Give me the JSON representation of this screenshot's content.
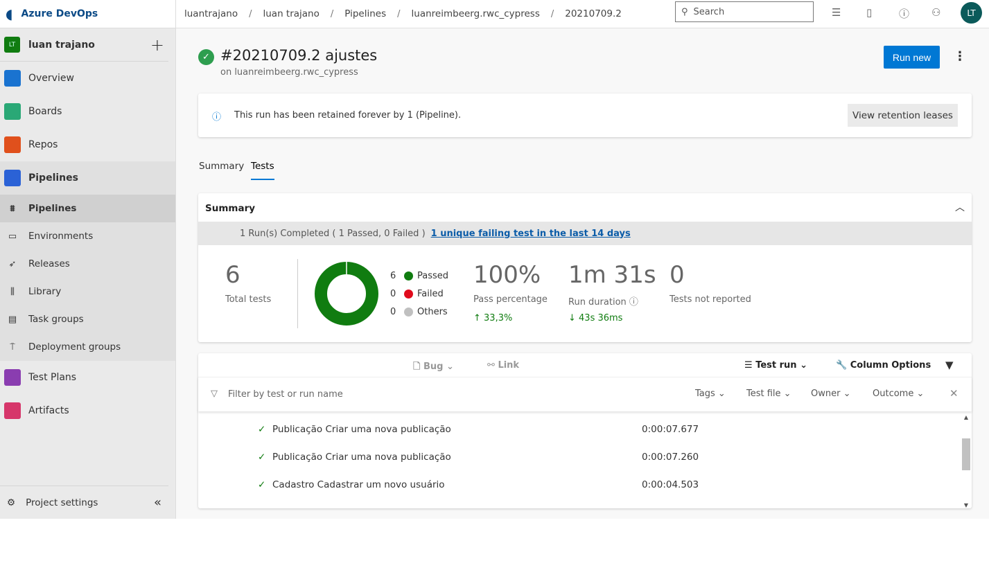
{
  "brand": "Azure DevOps",
  "project": {
    "initials": "LT",
    "name": "luan trajano"
  },
  "nav": [
    {
      "label": "Overview",
      "color": "#1a73d0"
    },
    {
      "label": "Boards",
      "color": "#2aa876"
    },
    {
      "label": "Repos",
      "color": "#e0501c"
    },
    {
      "label": "Pipelines",
      "color": "#2b62d6"
    }
  ],
  "subnav": [
    "Pipelines",
    "Environments",
    "Releases",
    "Library",
    "Task groups",
    "Deployment groups"
  ],
  "nav2": [
    {
      "label": "Test Plans",
      "color": "#8a3db0"
    },
    {
      "label": "Artifacts",
      "color": "#d6366a"
    }
  ],
  "project_settings": "Project settings",
  "breadcrumb": [
    "luantrajano",
    "luan trajano",
    "Pipelines",
    "luanreimbeerg.rwc_cypress",
    "20210709.2"
  ],
  "search_placeholder": "Search",
  "user_initials": "LT",
  "run": {
    "title": "#20210709.2 ajustes",
    "subtitle": "on luanreimbeerg.rwc_cypress",
    "run_new": "Run new"
  },
  "retention": {
    "message": "This run has been retained forever by 1 (Pipeline).",
    "button": "View retention leases"
  },
  "tabs": [
    "Summary",
    "Tests"
  ],
  "summary": {
    "heading": "Summary",
    "banner": "1 Run(s) Completed ( 1 Passed, 0 Failed )",
    "banner_link": "1 unique failing test in the last 14 days",
    "total": "6",
    "total_label": "Total tests",
    "legend": [
      {
        "count": "6",
        "label": "Passed",
        "color": "#107c10"
      },
      {
        "count": "0",
        "label": "Failed",
        "color": "#e00b1c"
      },
      {
        "count": "0",
        "label": "Others",
        "color": "#c0c0c0"
      }
    ],
    "pass": "100%",
    "pass_label": "Pass percentage",
    "pass_delta": "33,3%",
    "duration": "1m 31s",
    "duration_label": "Run duration",
    "duration_delta": "43s 36ms",
    "not_reported": "0",
    "not_reported_label": "Tests not reported"
  },
  "toolbar": {
    "bug": "Bug",
    "link": "Link",
    "test_run": "Test run",
    "column_options": "Column Options"
  },
  "filter": {
    "placeholder": "Filter by test or run name",
    "tags": "Tags",
    "test_file": "Test file",
    "owner": "Owner",
    "outcome": "Outcome"
  },
  "results": [
    {
      "name": "Publicação Criar uma nova publicação",
      "duration": "0:00:07.677"
    },
    {
      "name": "Publicação Criar uma nova publicação",
      "duration": "0:00:07.260"
    },
    {
      "name": "Cadastro Cadastrar um novo usuário",
      "duration": "0:00:04.503"
    }
  ]
}
